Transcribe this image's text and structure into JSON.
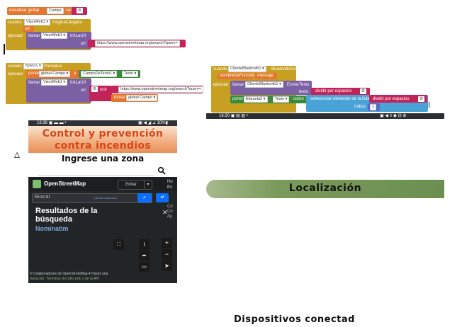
{
  "colors": {
    "var_orange": "#e4772f",
    "control_gold": "#c8a021",
    "proc_purple": "#7b60a4",
    "text_pink": "#c2245a",
    "comp_green": "#3a8a3c",
    "list_blue": "#4aa3d6",
    "math_blue": "#5b67c4",
    "banner_olive": "#7a9a5b",
    "osm_dark": "#222527"
  },
  "block_a": {
    "prefix": "inicializar global",
    "var_name": "Campo",
    "mid": "como",
    "gear_icon": "gear-icon"
  },
  "block_b": {
    "when": "cuando",
    "component": "VisorWeb1",
    "event": "PáginaCargada",
    "param": "url",
    "exec": "ejecutar",
    "call": "llamar",
    "call_comp": "VisorWeb1",
    "method": "IrALaUrl",
    "arg_label": "url",
    "url_value": "https://www.openstreetmap.org/search?query="
  },
  "block_c": {
    "when": "cuando",
    "component": "Botón1",
    "event": "Presionar",
    "exec": "ejecutar",
    "set": "poner",
    "var": "global Campo",
    "to": "a",
    "tb_comp": "CampoDeTexto1",
    "tb_prop": "Texto",
    "call": "llamar",
    "call_comp": "VisorWeb1",
    "method": "IrALaUrl",
    "arg_label": "url",
    "join": "unir",
    "url_value": "https://www.openstreetmap.org/search?query=",
    "get": "tomar",
    "get_var": "global Campo"
  },
  "block_d": {
    "when": "cuando",
    "component": "ClienteBluetooth1",
    "event": "BluetoothError",
    "p1": "nombreDeFunción",
    "p2": "mensaje",
    "exec": "ejecutar",
    "call": "llamar",
    "call_comp": "ClienteBluetooth1",
    "method": "EnviarTexto",
    "arg_label": "texto",
    "split": "dividir por espacios",
    "set": "poner",
    "set_comp": "Etiqueta2",
    "set_prop": "Texto",
    "to": "como",
    "select": "seleccionar elemento de la lista",
    "split2": "dividir por espacios",
    "index_label": "índice",
    "index_value": "1"
  },
  "strip": {
    "time": "16:30 ▣ ▤ ▥ •",
    "icons": "▣ ◀ ≡ ◉ ⊡ ⊕"
  },
  "phone": {
    "status_time": "16:36 ▣ ▬ ▬ •",
    "status_right": "▣ ◀ ◢ ⊿ 10%▮",
    "title_line1": "Control y prevención",
    "title_line2": "contra incendios",
    "zone_label": "Ingrese una zona",
    "search_icon": "search-icon",
    "osm_brand": "OpenStreetMap",
    "edit_label": "Editar",
    "side_menu": [
      "Ho",
      "Ex",
      "Hi"
    ],
    "search_placeholder": "Buscar",
    "where_link": "¿Dónde está esto?",
    "go_label": "Ir",
    "results_title": "Resultados de la búsqueda",
    "nominatim": "Nominatim",
    "side_text": [
      "Co",
      "Co",
      "Ay"
    ],
    "attribution_1": "© Colaboradores de OpenStreetMap ♥ Hacer una",
    "attribution_2": "donación. Términos del sitio web y de la API"
  },
  "warning_icon": "warning-triangle-icon",
  "localizacion_label": "Localización",
  "devices_label": "Dispositivos conectad"
}
